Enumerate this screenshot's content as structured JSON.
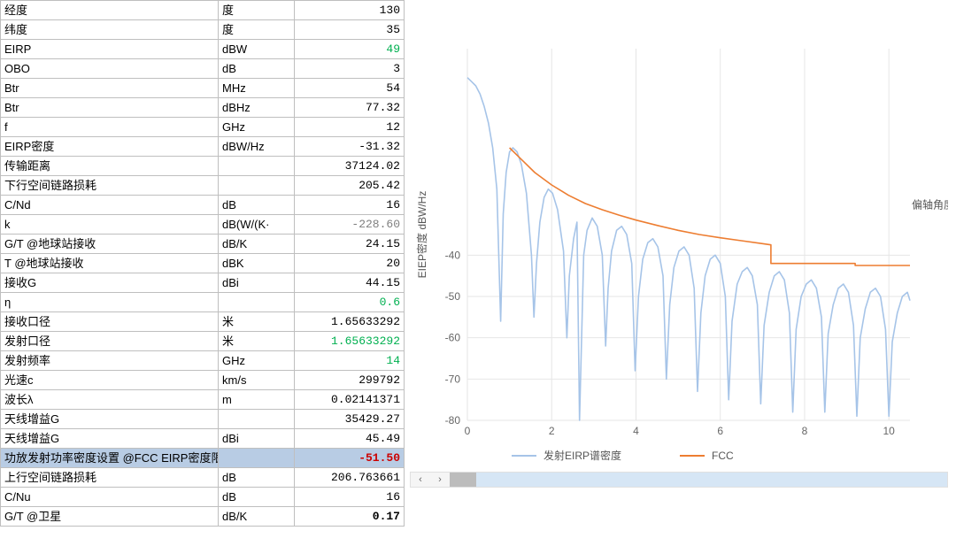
{
  "rows": [
    {
      "label": "经度",
      "unit": "度",
      "value": "130"
    },
    {
      "label": "纬度",
      "unit": "度",
      "value": "35"
    },
    {
      "label": "EIRP",
      "unit": "dBW",
      "value": "49",
      "valcls": "green"
    },
    {
      "label": "OBO",
      "unit": "dB",
      "value": "3"
    },
    {
      "label": "Btr",
      "unit": "MHz",
      "value": "54"
    },
    {
      "label": "Btr",
      "unit": "dBHz",
      "value": "77.32"
    },
    {
      "label": "f",
      "unit": "GHz",
      "value": "12"
    },
    {
      "label": "EIRP密度",
      "unit": "dBW/Hz",
      "value": "-31.32"
    },
    {
      "label": "传输距离",
      "unit": "",
      "value": "37124.02"
    },
    {
      "label": "下行空间链路损耗",
      "unit": "",
      "value": "205.42"
    },
    {
      "label": "C/Nd",
      "unit": "dB",
      "value": "16"
    },
    {
      "label": "k",
      "unit": "dB(W/(K·",
      "value": "-228.60",
      "valcls": "grey"
    },
    {
      "label": "G/T @地球站接收",
      "unit": "dB/K",
      "value": "24.15"
    },
    {
      "label": "T @地球站接收",
      "unit": "dBK",
      "value": "20"
    },
    {
      "label": "接收G",
      "unit": "dBi",
      "value": "44.15"
    },
    {
      "label": "η",
      "unit": "",
      "value": "0.6",
      "valcls": "green"
    },
    {
      "label": "接收口径",
      "unit": "米",
      "value": "1.65633292"
    },
    {
      "label": "发射口径",
      "unit": "米",
      "value": "1.65633292",
      "valcls": "green"
    },
    {
      "label": "发射频率",
      "unit": "GHz",
      "value": "14",
      "valcls": "green"
    },
    {
      "label": "光速c",
      "unit": "km/s",
      "value": "299792"
    },
    {
      "label": "波长λ",
      "unit": "m",
      "value": "0.02141371"
    },
    {
      "label": "天线增益G",
      "unit": "",
      "value": "35429.27"
    },
    {
      "label": "天线增益G",
      "unit": "dBi",
      "value": "45.49"
    },
    {
      "label": "功放发射功率密度设置 @FCC EIRP密度限制",
      "unit": "",
      "value": "-51.50",
      "valcls": "redbold",
      "rowcls": "hl"
    },
    {
      "label": "上行空间链路损耗",
      "unit": "dB",
      "value": "206.763661"
    },
    {
      "label": "C/Nu",
      "unit": "dB",
      "value": "16"
    },
    {
      "label": "G/T @卫星",
      "unit": "dB/K",
      "value": "0.17",
      "valcls": "bold"
    }
  ],
  "chart_data": {
    "type": "line",
    "xlabel": "偏轴角度 °",
    "ylabel": "EIEP密度  dBW/Hz",
    "xrange": [
      0,
      10.5
    ],
    "yrange": [
      -80,
      10
    ],
    "yticks": [
      -80,
      -70,
      -60,
      -50,
      -40
    ],
    "xticks": [
      0,
      2,
      4,
      6,
      8,
      10
    ],
    "legend": [
      "发射EIRP谱密度",
      "FCC"
    ],
    "series": [
      {
        "name": "发射EIRP谱密度",
        "color": "#a6c4e8",
        "pts": [
          [
            0.0,
            3
          ],
          [
            0.1,
            2
          ],
          [
            0.2,
            1
          ],
          [
            0.3,
            -1
          ],
          [
            0.4,
            -4
          ],
          [
            0.5,
            -8
          ],
          [
            0.6,
            -14
          ],
          [
            0.7,
            -24
          ],
          [
            0.79,
            -56
          ],
          [
            0.85,
            -30
          ],
          [
            0.92,
            -20
          ],
          [
            1.0,
            -15
          ],
          [
            1.08,
            -14
          ],
          [
            1.18,
            -15
          ],
          [
            1.28,
            -18
          ],
          [
            1.4,
            -25
          ],
          [
            1.52,
            -40
          ],
          [
            1.58,
            -55
          ],
          [
            1.64,
            -42
          ],
          [
            1.72,
            -32
          ],
          [
            1.82,
            -26
          ],
          [
            1.92,
            -24
          ],
          [
            2.02,
            -25
          ],
          [
            2.14,
            -29
          ],
          [
            2.28,
            -39
          ],
          [
            2.36,
            -60
          ],
          [
            2.42,
            -45
          ],
          [
            2.52,
            -36
          ],
          [
            2.6,
            -32
          ],
          [
            2.66,
            -80
          ],
          [
            2.76,
            -40
          ],
          [
            2.84,
            -34
          ],
          [
            2.96,
            -31
          ],
          [
            3.08,
            -33
          ],
          [
            3.2,
            -40
          ],
          [
            3.28,
            -62
          ],
          [
            3.34,
            -48
          ],
          [
            3.42,
            -39
          ],
          [
            3.54,
            -34
          ],
          [
            3.66,
            -33
          ],
          [
            3.78,
            -35
          ],
          [
            3.9,
            -42
          ],
          [
            3.98,
            -68
          ],
          [
            4.06,
            -50
          ],
          [
            4.16,
            -41
          ],
          [
            4.28,
            -37
          ],
          [
            4.4,
            -36
          ],
          [
            4.52,
            -38
          ],
          [
            4.64,
            -45
          ],
          [
            4.72,
            -70
          ],
          [
            4.8,
            -52
          ],
          [
            4.9,
            -43
          ],
          [
            5.02,
            -39
          ],
          [
            5.14,
            -38
          ],
          [
            5.26,
            -40
          ],
          [
            5.38,
            -48
          ],
          [
            5.46,
            -73
          ],
          [
            5.54,
            -54
          ],
          [
            5.64,
            -45
          ],
          [
            5.76,
            -41
          ],
          [
            5.88,
            -40
          ],
          [
            6.0,
            -42
          ],
          [
            6.12,
            -50
          ],
          [
            6.2,
            -75
          ],
          [
            6.28,
            -56
          ],
          [
            6.4,
            -47
          ],
          [
            6.52,
            -44
          ],
          [
            6.64,
            -43
          ],
          [
            6.76,
            -45
          ],
          [
            6.88,
            -52
          ],
          [
            6.96,
            -76
          ],
          [
            7.04,
            -57
          ],
          [
            7.16,
            -49
          ],
          [
            7.28,
            -45
          ],
          [
            7.4,
            -44
          ],
          [
            7.52,
            -46
          ],
          [
            7.64,
            -54
          ],
          [
            7.72,
            -78
          ],
          [
            7.8,
            -58
          ],
          [
            7.92,
            -50
          ],
          [
            8.04,
            -47
          ],
          [
            8.16,
            -46
          ],
          [
            8.28,
            -48
          ],
          [
            8.4,
            -55
          ],
          [
            8.48,
            -78
          ],
          [
            8.56,
            -59
          ],
          [
            8.68,
            -52
          ],
          [
            8.8,
            -48
          ],
          [
            8.92,
            -47
          ],
          [
            9.04,
            -49
          ],
          [
            9.16,
            -57
          ],
          [
            9.24,
            -79
          ],
          [
            9.32,
            -60
          ],
          [
            9.44,
            -53
          ],
          [
            9.56,
            -49
          ],
          [
            9.68,
            -48
          ],
          [
            9.8,
            -50
          ],
          [
            9.92,
            -58
          ],
          [
            10.0,
            -79
          ],
          [
            10.08,
            -61
          ],
          [
            10.2,
            -54
          ],
          [
            10.32,
            -50
          ],
          [
            10.44,
            -49
          ],
          [
            10.5,
            -51
          ]
        ]
      },
      {
        "name": "FCC",
        "color": "#ed7d31",
        "pts": [
          [
            1.0,
            -14
          ],
          [
            1.2,
            -16
          ],
          [
            1.4,
            -18
          ],
          [
            1.6,
            -20
          ],
          [
            1.8,
            -21.5
          ],
          [
            2.0,
            -23
          ],
          [
            2.4,
            -25.5
          ],
          [
            2.8,
            -27.5
          ],
          [
            3.2,
            -29
          ],
          [
            3.6,
            -30.3
          ],
          [
            4.0,
            -31.5
          ],
          [
            4.5,
            -32.8
          ],
          [
            5.0,
            -34
          ],
          [
            5.5,
            -35
          ],
          [
            6.0,
            -35.8
          ],
          [
            6.5,
            -36.5
          ],
          [
            7.0,
            -37.2
          ],
          [
            7.2,
            -37.5
          ],
          [
            7.2,
            -42
          ],
          [
            8.0,
            -42
          ],
          [
            9.0,
            -42
          ],
          [
            9.2,
            -42
          ],
          [
            9.2,
            -42.5
          ],
          [
            10.0,
            -42.5
          ],
          [
            10.5,
            -42.5
          ]
        ]
      }
    ]
  }
}
